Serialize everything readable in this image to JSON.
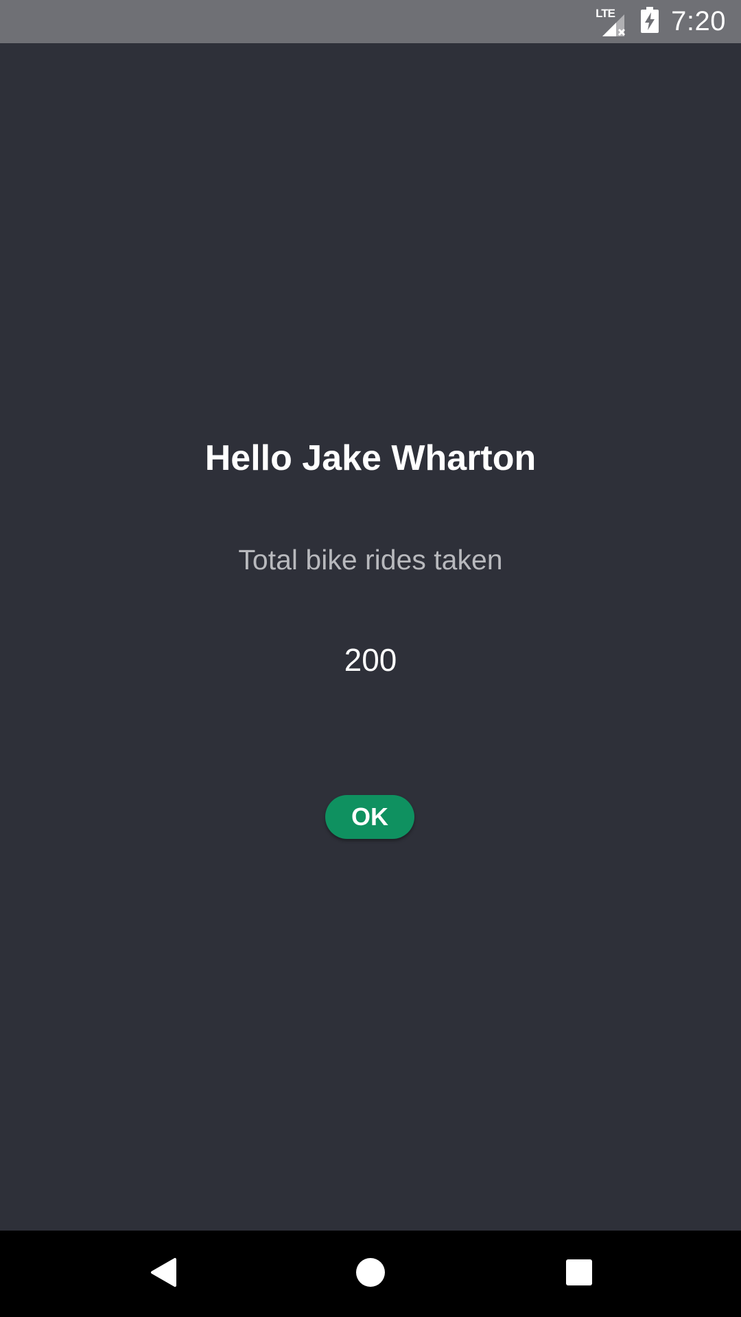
{
  "status_bar": {
    "time": "7:20",
    "network_label": "LTE",
    "icons": [
      "lte-signal-icon",
      "battery-charging-icon"
    ]
  },
  "main": {
    "greeting": "Hello Jake Wharton",
    "subtitle": "Total bike rides taken",
    "count": "200",
    "ok_label": "OK"
  },
  "nav_bar": {
    "icons": [
      "back-icon",
      "home-icon",
      "recents-icon"
    ]
  },
  "colors": {
    "background": "#2e3039",
    "status_bar": "#6f7075",
    "accent": "#0f9160",
    "nav_bar": "#000000"
  }
}
